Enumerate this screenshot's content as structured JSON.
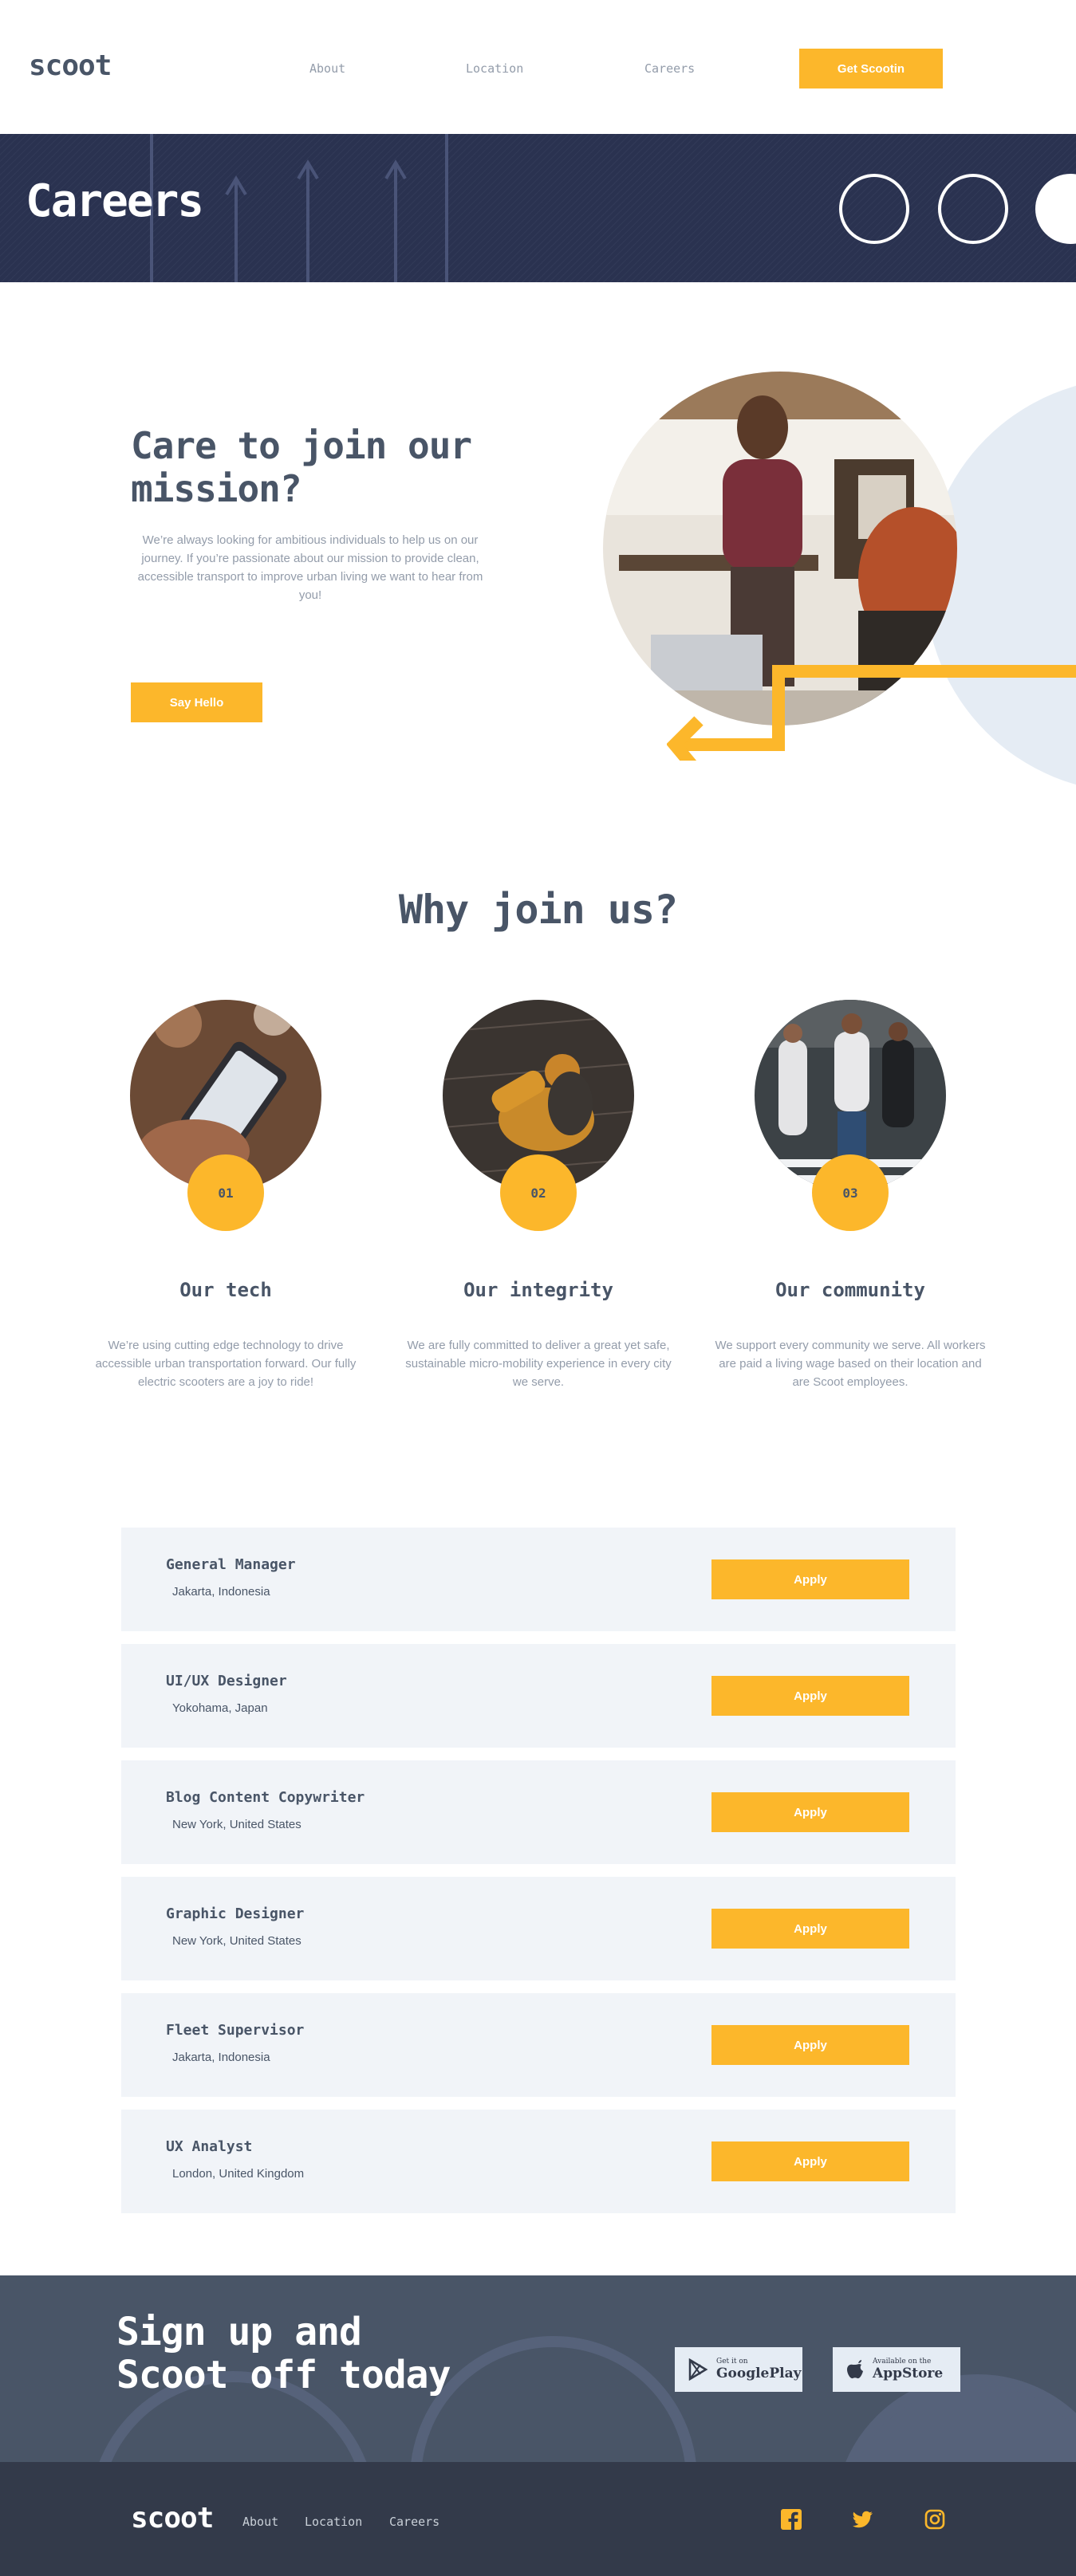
{
  "header": {
    "logo": "scoot",
    "nav": [
      "About",
      "Location",
      "Careers"
    ],
    "cta": "Get Scootin"
  },
  "banner": {
    "title": "Careers"
  },
  "mission": {
    "title": "Care to join our mission?",
    "text": "We’re always looking for ambitious individuals to help us on our journey. If you’re  passionate about our mission to provide clean, accessible transport to improve urban  living we want to hear from you!",
    "button": "Say Hello"
  },
  "why": {
    "title": "Why join us?",
    "features": [
      {
        "number": "01",
        "title": "Our tech",
        "text": "We’re using cutting edge technology to drive accessible urban transportation forward. Our fully electric scooters are a joy to ride!"
      },
      {
        "number": "02",
        "title": "Our integrity",
        "text": "We are fully committed to deliver a great yet safe, sustainable micro-mobility experience in every city we serve."
      },
      {
        "number": "03",
        "title": "Our community",
        "text": "We support every community we serve. All workers are paid a  living wage based on their location and are Scoot employees."
      }
    ]
  },
  "jobs": {
    "apply_label": "Apply",
    "items": [
      {
        "title": "General Manager",
        "location": "Jakarta, Indonesia"
      },
      {
        "title": "UI/UX Designer",
        "location": "Yokohama, Japan"
      },
      {
        "title": "Blog Content Copywriter",
        "location": "New York, United States"
      },
      {
        "title": "Graphic Designer",
        "location": "New York, United States"
      },
      {
        "title": "Fleet Supervisor",
        "location": "Jakarta, Indonesia"
      },
      {
        "title": "UX Analyst",
        "location": "London, United Kingdom"
      }
    ]
  },
  "signup": {
    "title_line1": "Sign up and",
    "title_line2": "Scoot off today",
    "google": {
      "small": "Get it on",
      "big": "GooglePlay",
      "icon": "google-play-icon"
    },
    "apple": {
      "small": "Available on the",
      "big": "AppStore",
      "icon": "apple-icon"
    }
  },
  "footer": {
    "logo": "scoot",
    "nav": [
      "About",
      "Location",
      "Careers"
    ],
    "social": [
      "facebook-icon",
      "twitter-icon",
      "instagram-icon"
    ]
  },
  "colors": {
    "accent": "#fcb72b",
    "dark": "#333a4a",
    "slate": "#495567",
    "muted": "#939caa",
    "light": "#f1f4f8"
  }
}
